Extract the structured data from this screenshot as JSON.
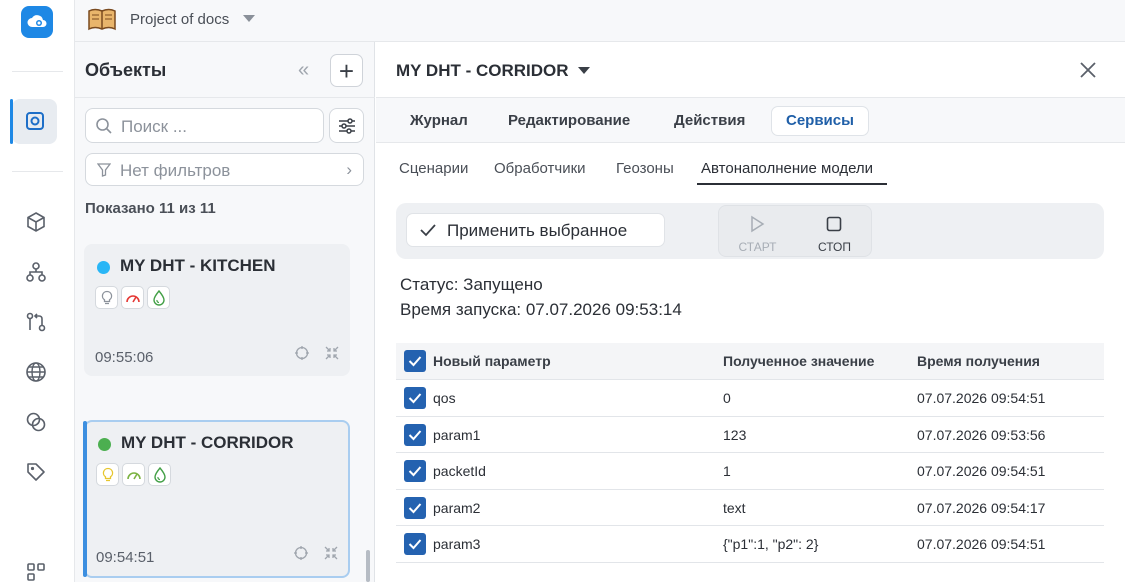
{
  "topbar": {
    "project": "Project of docs"
  },
  "objects": {
    "title": "Объекты",
    "search_placeholder": "Поиск ...",
    "no_filters": "Нет фильтров",
    "shown": "Показано 11 из 11",
    "items": [
      {
        "name": "MY DHT - KITCHEN",
        "time": "09:55:06",
        "status_color": "#29b6f6"
      },
      {
        "name": "MY DHT - CORRIDOR",
        "time": "09:54:51",
        "status_color": "#4caf50"
      }
    ]
  },
  "main": {
    "title": "MY DHT - CORRIDOR",
    "tabs": [
      {
        "label": "Журнал"
      },
      {
        "label": "Редактирование"
      },
      {
        "label": "Действия"
      },
      {
        "label": "Сервисы",
        "active": true
      }
    ],
    "subtabs": [
      {
        "label": "Сценарии"
      },
      {
        "label": "Обработчики"
      },
      {
        "label": "Геозоны"
      },
      {
        "label": "Автонаполнение модели",
        "active": true
      }
    ],
    "toolbar": {
      "apply_label": "Применить выбранное",
      "start_label": "СТАРТ",
      "stop_label": "СТОП"
    },
    "status": "Статус: Запущено",
    "started": "Время запуска: 07.07.2026 09:53:14",
    "table": {
      "headers": [
        "Новый параметр",
        "Полученное значение",
        "Время получения"
      ],
      "rows": [
        {
          "param": "qos",
          "value": "0",
          "time": "07.07.2026 09:54:51",
          "checked": true
        },
        {
          "param": "param1",
          "value": "123",
          "time": "07.07.2026 09:53:56",
          "checked": true
        },
        {
          "param": "packetId",
          "value": "1",
          "time": "07.07.2026 09:54:51",
          "checked": true
        },
        {
          "param": "param2",
          "value": "text",
          "time": "07.07.2026 09:54:17",
          "checked": true
        },
        {
          "param": "param3",
          "value": "{\"p1\":1, \"p2\": 2}",
          "time": "07.07.2026 09:54:51",
          "checked": true
        }
      ]
    }
  },
  "colors": {
    "accent": "#1e88e5",
    "checkbox": "#2462b0",
    "active_tab_text": "#1f5fa8"
  }
}
